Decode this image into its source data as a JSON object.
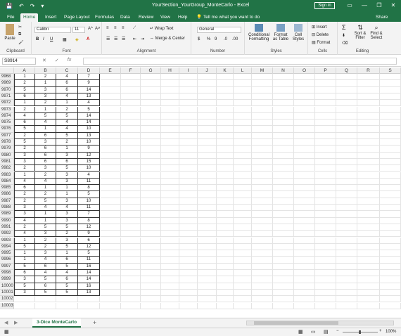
{
  "window": {
    "title": "YourSection_YourGroup_MonteCarlo - Excel",
    "signin": "Sign in",
    "minimize": "—",
    "restore": "❐",
    "close": "✕"
  },
  "quick_access": {
    "save": "💾",
    "undo": "↶",
    "redo": "↷",
    "more": "▾"
  },
  "tabs": [
    "File",
    "Home",
    "Insert",
    "Page Layout",
    "Formulas",
    "Data",
    "Review",
    "View",
    "Help"
  ],
  "active_tab": "Home",
  "tell_me": "Tell me what you want to do",
  "share": "Share",
  "ribbon": {
    "clipboard": {
      "label": "Clipboard",
      "paste": "Paste"
    },
    "font": {
      "label": "Font",
      "name": "Calibri",
      "size": "11",
      "bold": "B",
      "italic": "I",
      "underline": "U",
      "grow": "A^",
      "shrink": "A˅"
    },
    "alignment": {
      "label": "Alignment",
      "wrap": "Wrap Text",
      "merge": "Merge & Center"
    },
    "number": {
      "label": "Number",
      "format": "General",
      "currency": "$",
      "percent": "%",
      "comma": "9"
    },
    "styles": {
      "label": "Styles",
      "conditional": "Conditional Formatting",
      "format_table": "Format as Table",
      "cell_styles": "Cell Styles"
    },
    "cells": {
      "label": "Cells",
      "insert": "Insert",
      "delete": "Delete",
      "format": "Format"
    },
    "editing": {
      "label": "Editing",
      "sort": "Sort & Filter",
      "find": "Find & Select"
    }
  },
  "formula_bar": {
    "name_box": "S8914",
    "fx": "fx",
    "cancel": "✕",
    "enter": "✓",
    "value": ""
  },
  "columns": [
    "A",
    "B",
    "C",
    "D",
    "E",
    "F",
    "G",
    "H",
    "I",
    "J",
    "K",
    "L",
    "M",
    "N",
    "O",
    "P",
    "Q",
    "R",
    "S"
  ],
  "rows": [
    {
      "n": "9968",
      "v": [
        "1",
        "2",
        "4",
        "7"
      ]
    },
    {
      "n": "9969",
      "v": [
        "2",
        "1",
        "6",
        "9"
      ]
    },
    {
      "n": "9970",
      "v": [
        "5",
        "3",
        "6",
        "14"
      ]
    },
    {
      "n": "9971",
      "v": [
        "6",
        "3",
        "4",
        "13"
      ]
    },
    {
      "n": "9972",
      "v": [
        "1",
        "2",
        "1",
        "4"
      ]
    },
    {
      "n": "9973",
      "v": [
        "2",
        "1",
        "2",
        "5"
      ]
    },
    {
      "n": "9974",
      "v": [
        "4",
        "5",
        "5",
        "14"
      ]
    },
    {
      "n": "9975",
      "v": [
        "6",
        "4",
        "4",
        "14"
      ]
    },
    {
      "n": "9976",
      "v": [
        "5",
        "1",
        "4",
        "10"
      ]
    },
    {
      "n": "9977",
      "v": [
        "2",
        "6",
        "5",
        "13"
      ]
    },
    {
      "n": "9978",
      "v": [
        "5",
        "3",
        "2",
        "10"
      ]
    },
    {
      "n": "9979",
      "v": [
        "2",
        "6",
        "1",
        "9"
      ]
    },
    {
      "n": "9980",
      "v": [
        "3",
        "6",
        "3",
        "12"
      ]
    },
    {
      "n": "9981",
      "v": [
        "3",
        "6",
        "6",
        "15"
      ]
    },
    {
      "n": "9982",
      "v": [
        "2",
        "3",
        "5",
        "10"
      ]
    },
    {
      "n": "9983",
      "v": [
        "1",
        "2",
        "3",
        "4"
      ]
    },
    {
      "n": "9984",
      "v": [
        "4",
        "4",
        "3",
        "11"
      ]
    },
    {
      "n": "9985",
      "v": [
        "6",
        "1",
        "1",
        "8"
      ]
    },
    {
      "n": "9986",
      "v": [
        "2",
        "2",
        "1",
        "5"
      ]
    },
    {
      "n": "9987",
      "v": [
        "2",
        "5",
        "3",
        "10"
      ]
    },
    {
      "n": "9988",
      "v": [
        "3",
        "4",
        "4",
        "11"
      ]
    },
    {
      "n": "9989",
      "v": [
        "3",
        "1",
        "3",
        "7"
      ]
    },
    {
      "n": "9990",
      "v": [
        "4",
        "1",
        "3",
        "8"
      ]
    },
    {
      "n": "9991",
      "v": [
        "2",
        "5",
        "5",
        "12"
      ]
    },
    {
      "n": "9992",
      "v": [
        "4",
        "3",
        "2",
        "9"
      ]
    },
    {
      "n": "9993",
      "v": [
        "1",
        "2",
        "3",
        "6"
      ]
    },
    {
      "n": "9994",
      "v": [
        "5",
        "2",
        "5",
        "12"
      ]
    },
    {
      "n": "9995",
      "v": [
        "1",
        "3",
        "1",
        "5"
      ]
    },
    {
      "n": "9996",
      "v": [
        "1",
        "4",
        "6",
        "11"
      ]
    },
    {
      "n": "9997",
      "v": [
        "5",
        "6",
        "5",
        "16"
      ]
    },
    {
      "n": "9998",
      "v": [
        "6",
        "4",
        "4",
        "14"
      ]
    },
    {
      "n": "9999",
      "v": [
        "3",
        "5",
        "6",
        "14"
      ]
    },
    {
      "n": "10000",
      "v": [
        "5",
        "6",
        "5",
        "16"
      ]
    },
    {
      "n": "10001",
      "v": [
        "3",
        "5",
        "5",
        "13"
      ]
    },
    {
      "n": "10002",
      "v": [
        "",
        "",
        "",
        ""
      ]
    },
    {
      "n": "10003",
      "v": [
        "",
        "",
        "",
        ""
      ]
    }
  ],
  "sheet_tab": "3-Dice MonteCarlo",
  "add_sheet": "+",
  "status": {
    "zoom": "100%",
    "zoom_minus": "−",
    "zoom_plus": "+"
  },
  "colors": {
    "accent": "#217346"
  }
}
